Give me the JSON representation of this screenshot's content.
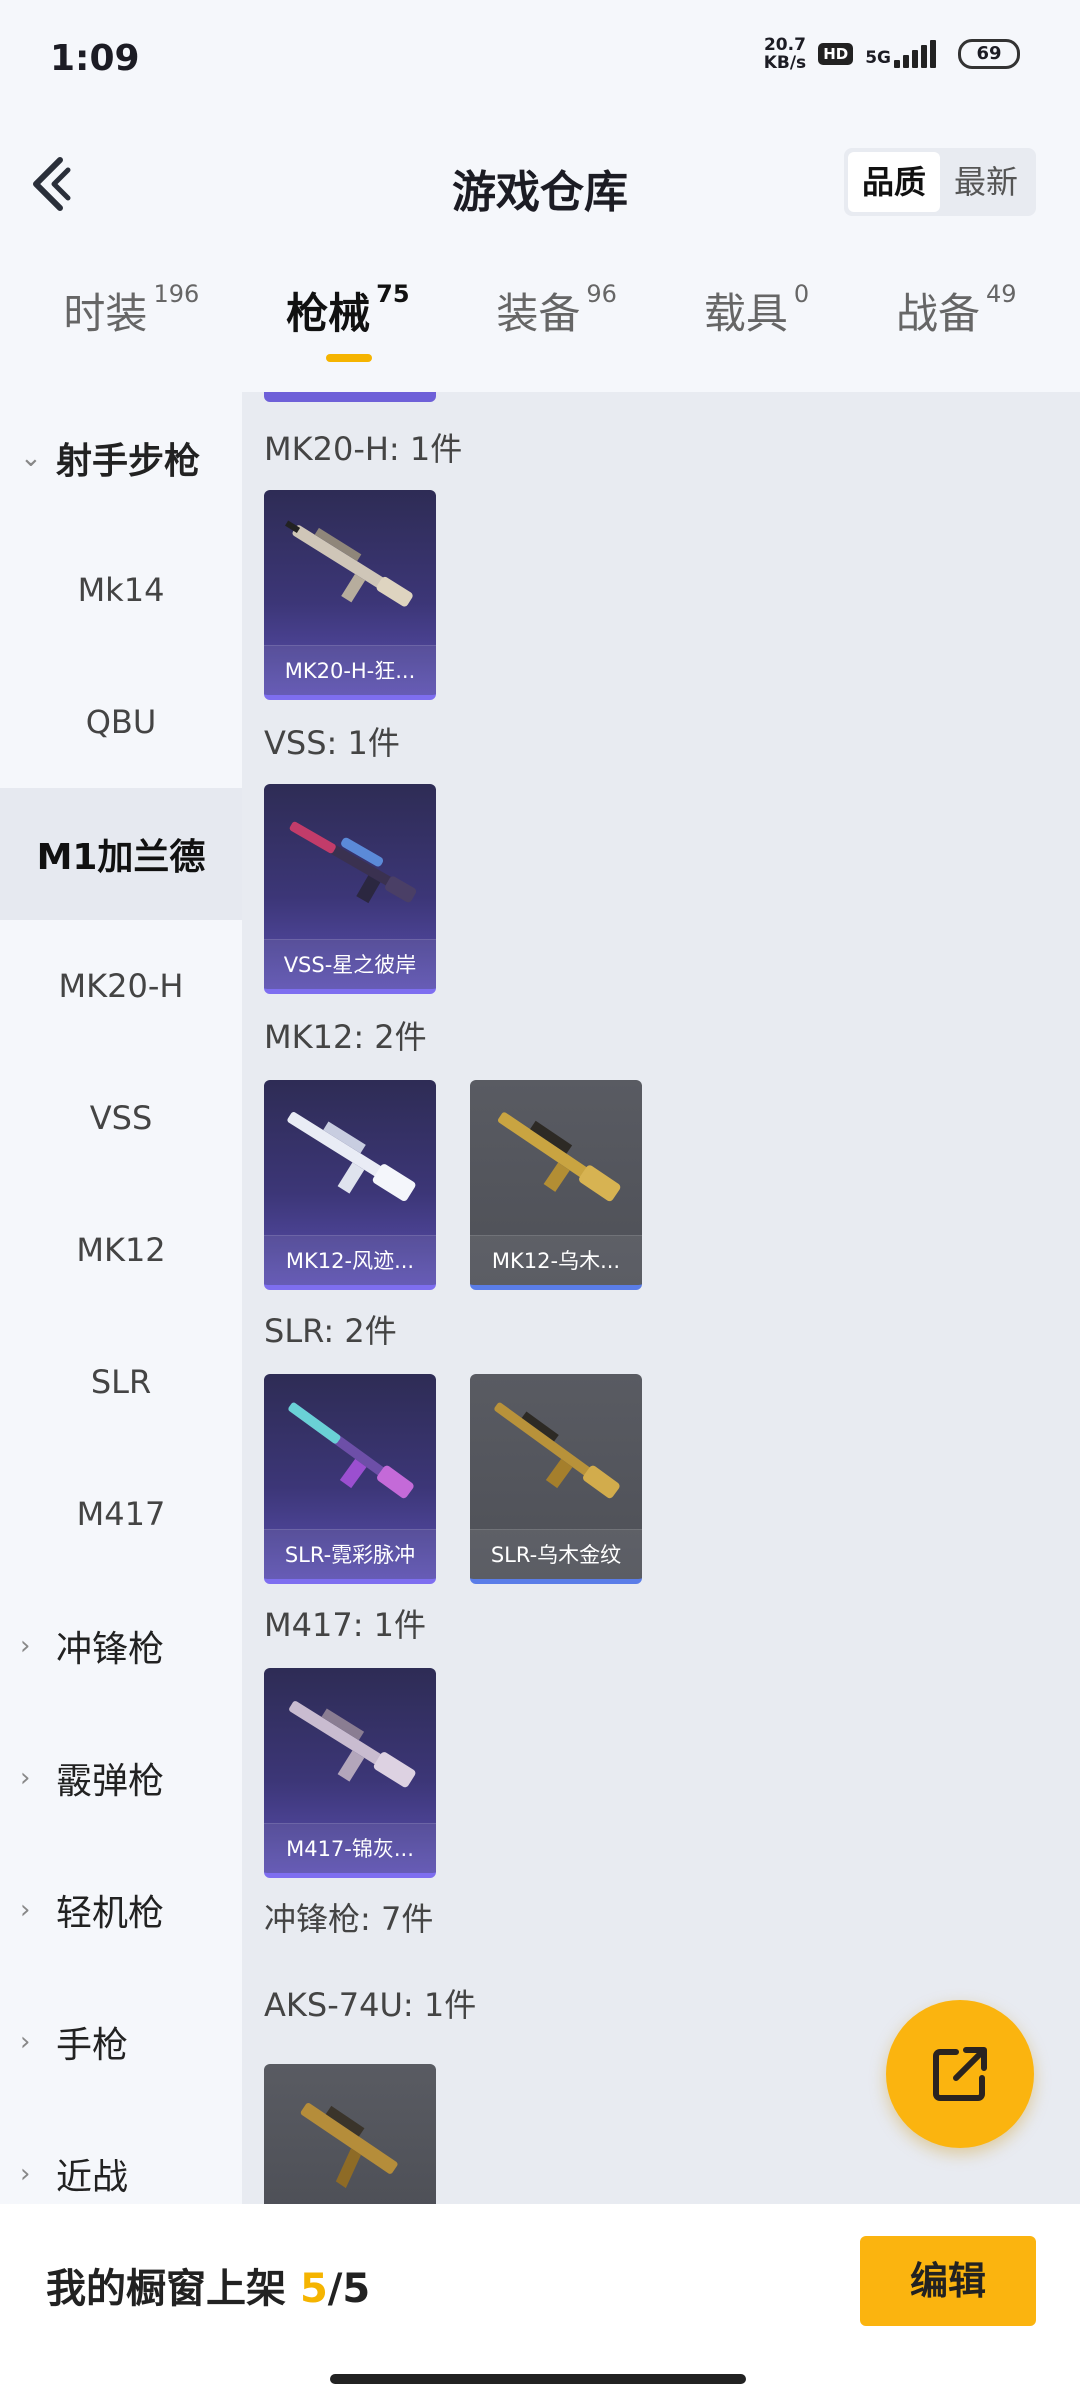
{
  "status_bar": {
    "time": "1:09",
    "net_speed_value": "20.7",
    "net_speed_unit": "KB/s",
    "hd": "HD",
    "network": "5G",
    "battery": "69"
  },
  "header": {
    "title": "游戏仓库",
    "sort_options": [
      "品质",
      "最新"
    ],
    "sort_selected": "品质"
  },
  "tabs": [
    {
      "label": "时装",
      "count": "196"
    },
    {
      "label": "枪械",
      "count": "75",
      "active": true
    },
    {
      "label": "装备",
      "count": "96"
    },
    {
      "label": "载具",
      "count": "0"
    },
    {
      "label": "战备",
      "count": "49"
    }
  ],
  "sidebar": {
    "group_open": "射手步枪",
    "sub_items": [
      "Mk14",
      "QBU",
      "M1加兰德",
      "MK20-H",
      "VSS",
      "MK12",
      "SLR",
      "M417"
    ],
    "active_item": "M1加兰德",
    "groups": [
      "冲锋枪",
      "霰弹枪",
      "轻机枪",
      "手枪",
      "近战"
    ]
  },
  "content": {
    "sections": [
      {
        "label": "MK20-H: 1件",
        "items": [
          {
            "name": "MK20-H-狂...",
            "quality": "purple"
          }
        ]
      },
      {
        "label": "VSS: 1件",
        "items": [
          {
            "name": "VSS-星之彼岸",
            "quality": "purple"
          }
        ]
      },
      {
        "label": "MK12: 2件",
        "items": [
          {
            "name": "MK12-风迹...",
            "quality": "purple"
          },
          {
            "name": "MK12-乌木...",
            "quality": "gray"
          }
        ]
      },
      {
        "label": "SLR: 2件",
        "items": [
          {
            "name": "SLR-霓彩脉冲",
            "quality": "purple"
          },
          {
            "name": "SLR-乌木金纹",
            "quality": "gray"
          }
        ]
      },
      {
        "label": "M417: 1件",
        "items": [
          {
            "name": "M417-锦灰...",
            "quality": "purple"
          }
        ]
      }
    ],
    "category_label": "冲锋枪: 7件",
    "next_section_label": "AKS-74U: 1件"
  },
  "bottom_bar": {
    "label_prefix": "我的橱窗上架 ",
    "shown": "5",
    "separator": "/",
    "total": "5",
    "edit_label": "编辑"
  },
  "colors": {
    "accent": "#fbb40f",
    "purple_quality": "#7e6ef0",
    "gray_quality_bar": "#5a7de8"
  }
}
